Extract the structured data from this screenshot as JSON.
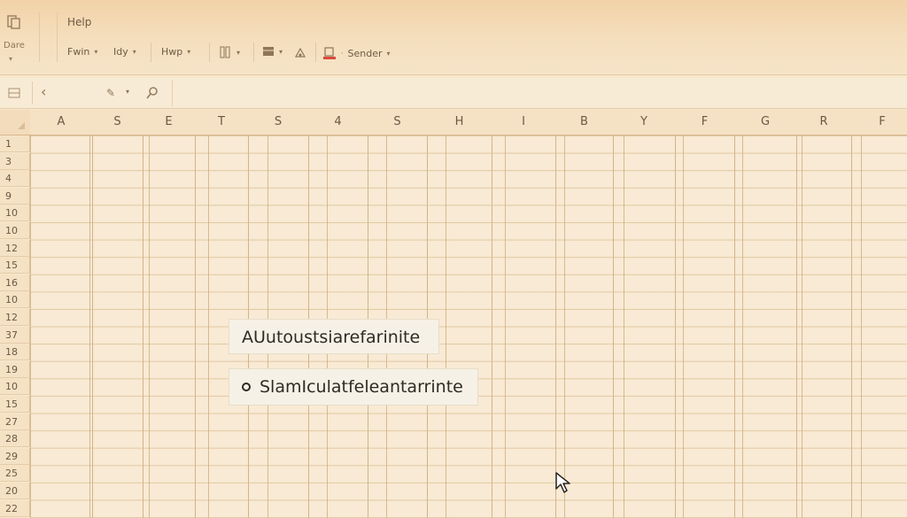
{
  "ribbon": {
    "file_label": "Dare",
    "file_arrow": "▾",
    "help_label": "Help",
    "tools": [
      {
        "label": "Fwin",
        "caret": "▾"
      },
      {
        "label": "Idy",
        "caret": "▾"
      },
      {
        "label": "Hwp",
        "caret": "▾"
      },
      {
        "label": "Sender",
        "caret": "▾"
      }
    ],
    "icons": [
      "file-icon",
      "columns-icon",
      "table-icon",
      "paint-icon",
      "text-color-icon"
    ],
    "accent_color": "#d84a3c"
  },
  "formula_bar": {
    "back_symbol": "‹",
    "pencil_symbol": "✎",
    "pencil_caret": "▾"
  },
  "grid": {
    "columns": [
      "A",
      "S",
      "E",
      "T",
      "S",
      "4",
      "S",
      "H",
      "I",
      "B",
      "Y",
      "F",
      "G",
      "R",
      "F"
    ],
    "rows": [
      "1",
      "3",
      "4",
      "9",
      "10",
      "10",
      "12",
      "15",
      "16",
      "10",
      "12",
      "37",
      "18",
      "19",
      "10",
      "15",
      "27",
      "28",
      "29",
      "25",
      "20",
      "22"
    ]
  },
  "autocomplete": {
    "option_1": "AUutoustsiarefarinite",
    "option_2": "SlamIculatfeleantarrinte"
  }
}
